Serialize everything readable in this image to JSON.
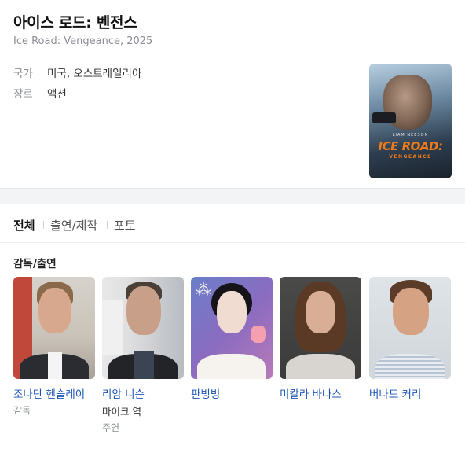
{
  "movie": {
    "title": "아이스 로드: 벤전스",
    "subtitle": "Ice Road: Vengeance, 2025",
    "info": [
      {
        "label": "국가",
        "value": "미국, 오스트레일리아"
      },
      {
        "label": "장르",
        "value": "액션"
      }
    ],
    "poster": {
      "actor_text": "LIAM NEESON",
      "logo_text": "ICE ROAD:",
      "logo_sub": "VENGEANCE"
    }
  },
  "tabs": [
    {
      "label": "전체",
      "active": true
    },
    {
      "label": "출연/제작",
      "active": false
    },
    {
      "label": "포토",
      "active": false
    }
  ],
  "cast_section": {
    "title": "감독/출연",
    "people": [
      {
        "name": "조나단 헨슬레이",
        "role": "",
        "sub": "감독"
      },
      {
        "name": "리암 니슨",
        "role": "마이크 역",
        "sub": "주연"
      },
      {
        "name": "판빙빙",
        "role": "",
        "sub": ""
      },
      {
        "name": "미칼라 바나스",
        "role": "",
        "sub": ""
      },
      {
        "name": "버나드 커리",
        "role": "",
        "sub": ""
      }
    ]
  },
  "colors": {
    "link": "#1a56b8",
    "muted": "#8a8d93",
    "poster_logo": "#f07a1a"
  }
}
